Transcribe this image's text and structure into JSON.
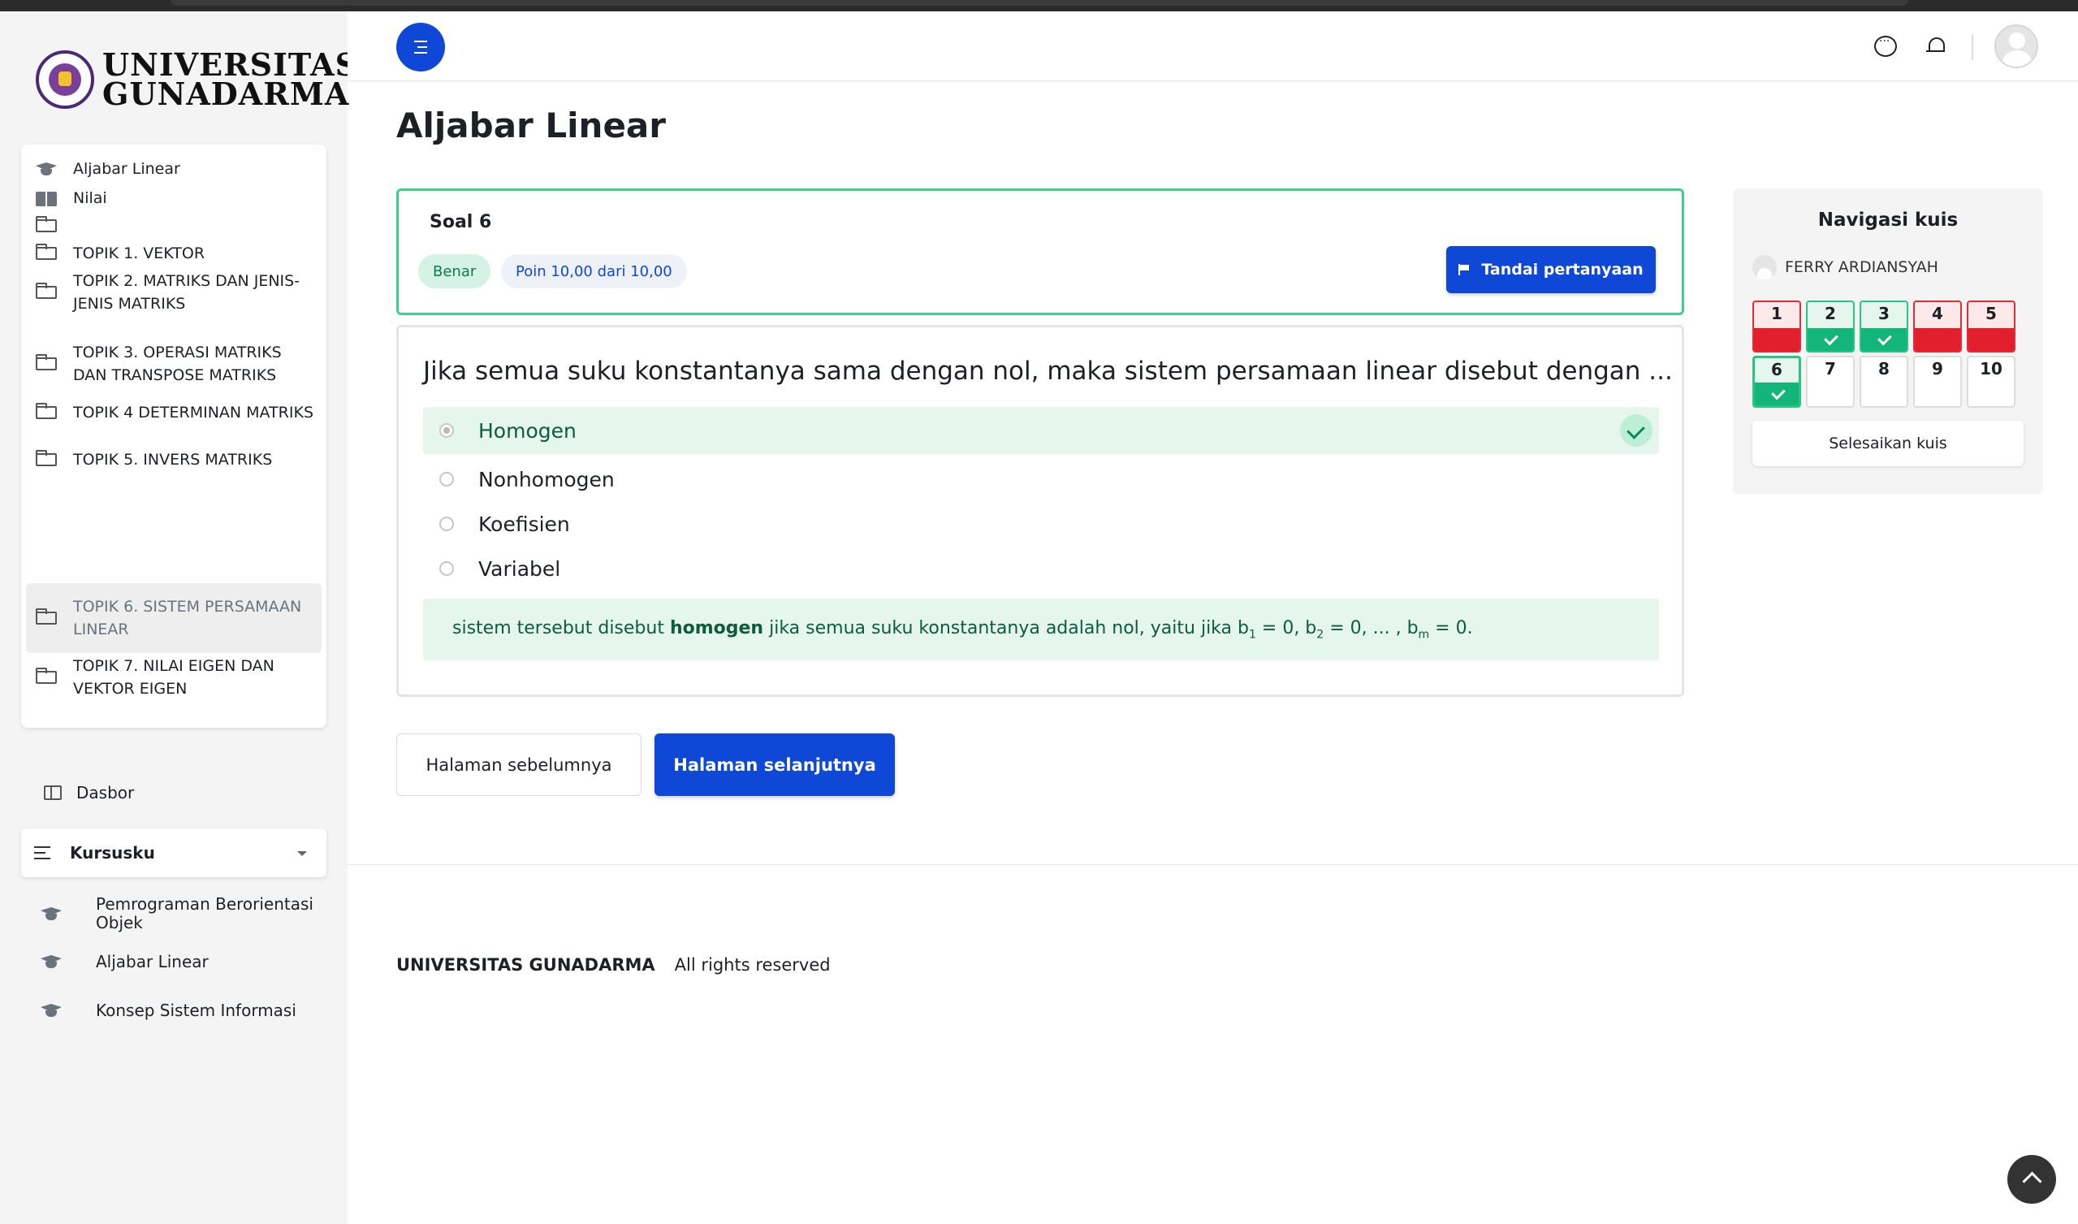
{
  "logo": {
    "line1": "UNIVERSITAS",
    "line2": "GUNADARMA",
    "seal_text": "UNIVERSITAS GUNADARMA"
  },
  "course_index": {
    "items": [
      {
        "label": "Aljabar Linear",
        "icon": "graduation-cap-icon"
      },
      {
        "label": "Nilai",
        "icon": "book-icon"
      },
      {
        "label": "",
        "icon": "folder-icon"
      },
      {
        "label": "TOPIK 1. VEKTOR",
        "icon": "folder-icon"
      },
      {
        "label": "TOPIK 2. MATRIKS DAN JENIS-JENIS MATRIKS",
        "icon": "folder-icon"
      },
      {
        "label": "TOPIK 3. OPERASI MATRIKS DAN TRANSPOSE MATRIKS",
        "icon": "folder-icon"
      },
      {
        "label": "TOPIK 4 DETERMINAN MATRIKS",
        "icon": "folder-icon"
      },
      {
        "label": "TOPIK 5. INVERS MATRIKS",
        "icon": "folder-icon"
      },
      {
        "label": "TOPIK 6. SISTEM PERSAMAAN LINEAR",
        "icon": "folder-icon",
        "active": true
      },
      {
        "label": "TOPIK 7. NILAI EIGEN DAN VEKTOR EIGEN",
        "icon": "folder-icon"
      }
    ]
  },
  "nav": {
    "dasbor": "Dasbor",
    "kursusku": "Kursusku",
    "courses": [
      {
        "label": "Pemrograman Berorientasi Objek"
      },
      {
        "label": "Aljabar Linear"
      },
      {
        "label": "Konsep Sistem Informasi"
      }
    ]
  },
  "page": {
    "title": "Aljabar Linear"
  },
  "question": {
    "number_label": "Soal 6",
    "state": "Benar",
    "points": "Poin 10,00 dari 10,00",
    "flag_label": "Tandai pertanyaan",
    "text": "Jika semua suku konstantanya sama dengan nol, maka sistem persamaan linear disebut dengan ...",
    "answers": [
      {
        "label": "Homogen",
        "selected": true,
        "correct": true
      },
      {
        "label": "Nonhomogen"
      },
      {
        "label": "Koefisien"
      },
      {
        "label": "Variabel"
      }
    ],
    "feedback": {
      "before": "sistem tersebut disebut ",
      "bold": "homogen",
      "after": " jika semua suku konstantanya adalah nol, yaitu jika b",
      "sub1": "1",
      "mid1": " = 0, b",
      "sub2": "2",
      "mid2": " = 0, ... , b",
      "subm": "m",
      "end": " = 0."
    }
  },
  "buttons": {
    "prev": "Halaman sebelumnya",
    "next": "Halaman selanjutnya"
  },
  "footer": {
    "brand": "UNIVERSITAS GUNADARMA",
    "rights": "All rights reserved"
  },
  "quiz_nav": {
    "title": "Navigasi kuis",
    "user": "FERRY ARDIANSYAH",
    "questions": [
      {
        "n": "1",
        "state": "incorrect"
      },
      {
        "n": "2",
        "state": "correct"
      },
      {
        "n": "3",
        "state": "correct"
      },
      {
        "n": "4",
        "state": "incorrect"
      },
      {
        "n": "5",
        "state": "incorrect"
      },
      {
        "n": "6",
        "state": "correct",
        "current": true
      },
      {
        "n": "7",
        "state": "notyet"
      },
      {
        "n": "8",
        "state": "notyet"
      },
      {
        "n": "9",
        "state": "notyet"
      },
      {
        "n": "10",
        "state": "notyet"
      }
    ],
    "finish": "Selesaikan kuis"
  },
  "colors": {
    "primary": "#0f47d6",
    "correct": "#13b57a",
    "incorrect": "#e21f2d"
  }
}
